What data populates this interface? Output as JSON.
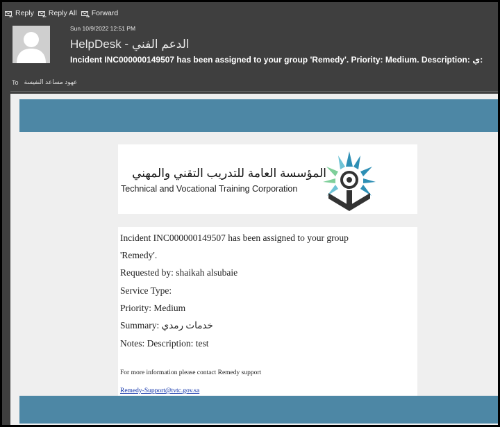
{
  "toolbar": {
    "reply_label": "Reply",
    "reply_all_label": "Reply All",
    "forward_label": "Forward"
  },
  "email": {
    "date": "Sun 10/9/2022 12:51 PM",
    "sender": "HelpDesk - الدعم الفني",
    "subject": "Incident INC000000149507 has been assigned to your group 'Remedy'. Priority: Medium. Description: ي:",
    "to_label": "To",
    "to_name": "عهود مساعد النفيسة"
  },
  "banner": {
    "org_name_ar": "المؤسسة العامة للتدريب التقني والمهني",
    "org_name_en": "Technical and Vocational Training Corporation"
  },
  "message": {
    "line1": "Incident INC000000149507 has been assigned to your group",
    "line2": "'Remedy'.",
    "requested_by": "Requested by: shaikah alsubaie",
    "service_type": "Service Type:",
    "priority": "Priority: Medium",
    "summary_label": "Summary:",
    "summary_value": "خدمات رمدي",
    "notes": "Notes: Description: test",
    "contact_text": "For more information please contact Remedy support",
    "support_email": "Remedy-Support@tvtc.gov.sa"
  },
  "colors": {
    "header_bg": "#3f3f3f",
    "band": "#4d87a5",
    "link": "#0b2fa8"
  }
}
